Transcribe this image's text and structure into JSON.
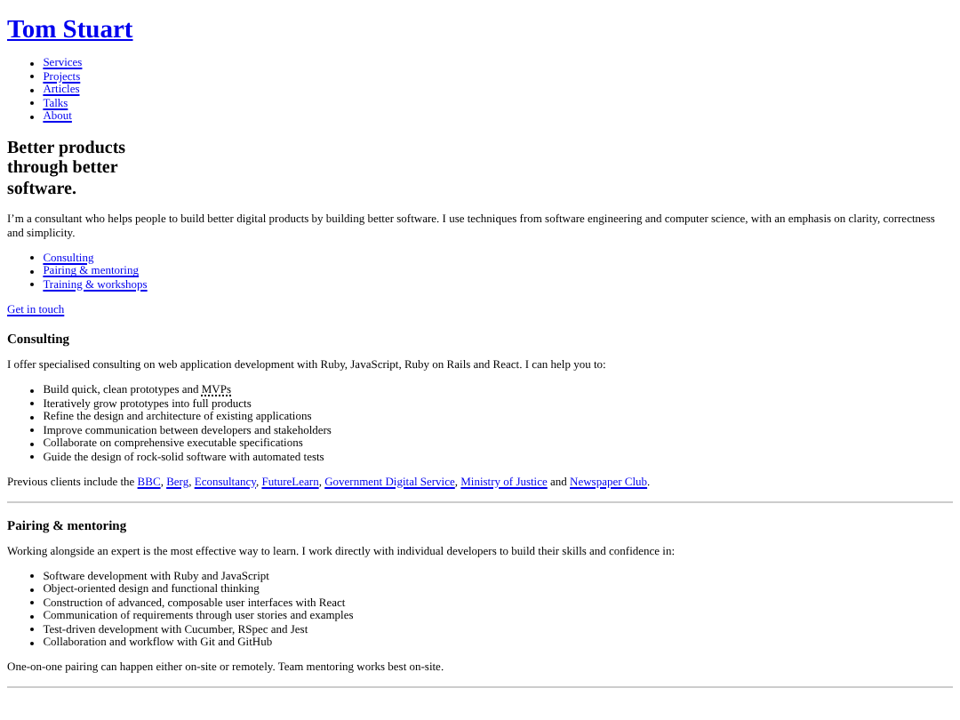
{
  "site_title": "Tom Stuart",
  "nav": [
    "Services",
    "Projects",
    "Articles",
    "Talks",
    "About"
  ],
  "tagline": "Better products through better software.",
  "intro": "I’m a consultant who helps people to build better digital products by building better software. I use techniques from software engineering and computer science, with an emphasis on clarity, correctness and simplicity.",
  "section_links": [
    "Consulting",
    "Pairing & mentoring",
    "Training & workshops"
  ],
  "contact_link": "Get in touch",
  "sections": [
    {
      "heading": "Consulting",
      "lead": "I offer specialised consulting on web application development with Ruby, JavaScript, Ruby on Rails and React. I can help you to:",
      "items": [
        {
          "text": "Build quick, clean prototypes and ",
          "abbr": "MVPs"
        },
        {
          "text": "Iteratively grow prototypes into full products"
        },
        {
          "text": "Refine the design and architecture of existing applications"
        },
        {
          "text": "Improve communication between developers and stakeholders"
        },
        {
          "text": "Collaborate on comprehensive executable specifications"
        },
        {
          "text": "Guide the design of rock-solid software with automated tests"
        }
      ],
      "closing": [
        {
          "kind": "text",
          "text": "Previous clients include the "
        },
        {
          "kind": "link",
          "text": "BBC"
        },
        {
          "kind": "text",
          "text": ", "
        },
        {
          "kind": "link",
          "text": "Berg"
        },
        {
          "kind": "text",
          "text": ", "
        },
        {
          "kind": "link",
          "text": "Econsultancy"
        },
        {
          "kind": "text",
          "text": ", "
        },
        {
          "kind": "link",
          "text": "FutureLearn"
        },
        {
          "kind": "text",
          "text": ", "
        },
        {
          "kind": "link",
          "text": "Government Digital Service"
        },
        {
          "kind": "text",
          "text": ", "
        },
        {
          "kind": "link",
          "text": "Ministry of Justice"
        },
        {
          "kind": "text",
          "text": " and "
        },
        {
          "kind": "link",
          "text": "Newspaper Club"
        },
        {
          "kind": "text",
          "text": "."
        }
      ]
    },
    {
      "heading": "Pairing & mentoring",
      "lead": "Working alongside an expert is the most effective way to learn. I work directly with individual developers to build their skills and confidence in:",
      "items": [
        {
          "text": "Software development with Ruby and JavaScript"
        },
        {
          "text": "Object-oriented design and functional thinking"
        },
        {
          "text": "Construction of advanced, composable user interfaces with React"
        },
        {
          "text": "Communication of requirements through user stories and examples"
        },
        {
          "text": "Test-driven development with Cucumber, RSpec and Jest"
        },
        {
          "text": "Collaboration and workflow with Git and GitHub"
        }
      ],
      "closing": [
        {
          "kind": "text",
          "text": "One-on-one pairing can happen either on-site or remotely. Team mentoring works best on-site."
        }
      ]
    }
  ]
}
